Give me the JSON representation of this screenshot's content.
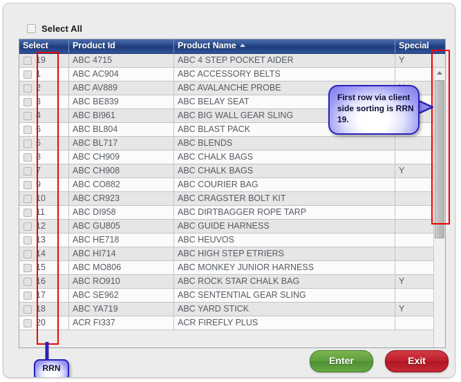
{
  "select_all": {
    "label": "Select All",
    "checked": false
  },
  "grid": {
    "columns": [
      {
        "key": "select",
        "label": "Select",
        "sorted": false
      },
      {
        "key": "prodid",
        "label": "Product Id",
        "sorted": false
      },
      {
        "key": "name",
        "label": "Product Name",
        "sorted": true,
        "sort_dir": "asc"
      },
      {
        "key": "special",
        "label": "Special",
        "sorted": false
      }
    ],
    "rows": [
      {
        "rrn": "19",
        "product_id": "ABC 4715",
        "product_name": "ABC 4 STEP POCKET AIDER",
        "special": "Y"
      },
      {
        "rrn": "1",
        "product_id": "ABC AC904",
        "product_name": "ABC ACCESSORY BELTS",
        "special": ""
      },
      {
        "rrn": "2",
        "product_id": "ABC AV889",
        "product_name": "ABC AVALANCHE PROBE",
        "special": "Y"
      },
      {
        "rrn": "3",
        "product_id": "ABC BE839",
        "product_name": "ABC BELAY SEAT",
        "special": ""
      },
      {
        "rrn": "4",
        "product_id": "ABC BI961",
        "product_name": "ABC BIG WALL GEAR SLING",
        "special": ""
      },
      {
        "rrn": "6",
        "product_id": "ABC BL804",
        "product_name": "ABC BLAST PACK",
        "special": ""
      },
      {
        "rrn": "5",
        "product_id": "ABC BL717",
        "product_name": "ABC BLENDS",
        "special": ""
      },
      {
        "rrn": "8",
        "product_id": "ABC CH909",
        "product_name": "ABC CHALK BAGS",
        "special": ""
      },
      {
        "rrn": "7",
        "product_id": "ABC CH908",
        "product_name": "ABC CHALK BAGS",
        "special": "Y"
      },
      {
        "rrn": "9",
        "product_id": "ABC CO882",
        "product_name": "ABC COURIER BAG",
        "special": ""
      },
      {
        "rrn": "10",
        "product_id": "ABC CR923",
        "product_name": "ABC CRAGSTER BOLT KIT",
        "special": ""
      },
      {
        "rrn": "11",
        "product_id": "ABC DI958",
        "product_name": "ABC DIRTBAGGER ROPE TARP",
        "special": ""
      },
      {
        "rrn": "12",
        "product_id": "ABC GU805",
        "product_name": "ABC GUIDE HARNESS",
        "special": ""
      },
      {
        "rrn": "13",
        "product_id": "ABC HE718",
        "product_name": "ABC HEUVOS",
        "special": ""
      },
      {
        "rrn": "14",
        "product_id": "ABC HI714",
        "product_name": "ABC HIGH STEP ETRIERS",
        "special": ""
      },
      {
        "rrn": "15",
        "product_id": "ABC MO806",
        "product_name": "ABC MONKEY JUNIOR HARNESS",
        "special": ""
      },
      {
        "rrn": "16",
        "product_id": "ABC RO910",
        "product_name": "ABC ROCK STAR CHALK BAG",
        "special": "Y"
      },
      {
        "rrn": "17",
        "product_id": "ABC SE962",
        "product_name": "ABC SENTENTIAL GEAR SLING",
        "special": ""
      },
      {
        "rrn": "18",
        "product_id": "ABC YA719",
        "product_name": "ABC YARD STICK",
        "special": "Y"
      },
      {
        "rrn": "20",
        "product_id": "ACR FI337",
        "product_name": "ACR FIREFLY PLUS",
        "special": ""
      }
    ]
  },
  "scrollbar": {
    "up_icon": "triangle-up-icon",
    "down_icon": "triangle-down-icon"
  },
  "annotations": {
    "callout_sorting": "First row via client side sorting is RRN 19.",
    "callout_rrn": "RRN",
    "highlight_color": "#ee0000"
  },
  "buttons": {
    "enter": "Enter",
    "exit": "Exit"
  },
  "colors": {
    "header_blue": "#27488b",
    "enter_green": "#5e9e3c",
    "exit_red": "#bf1f2d",
    "callout_blue": "#2a22b8",
    "highlight_red": "#ee0000"
  }
}
